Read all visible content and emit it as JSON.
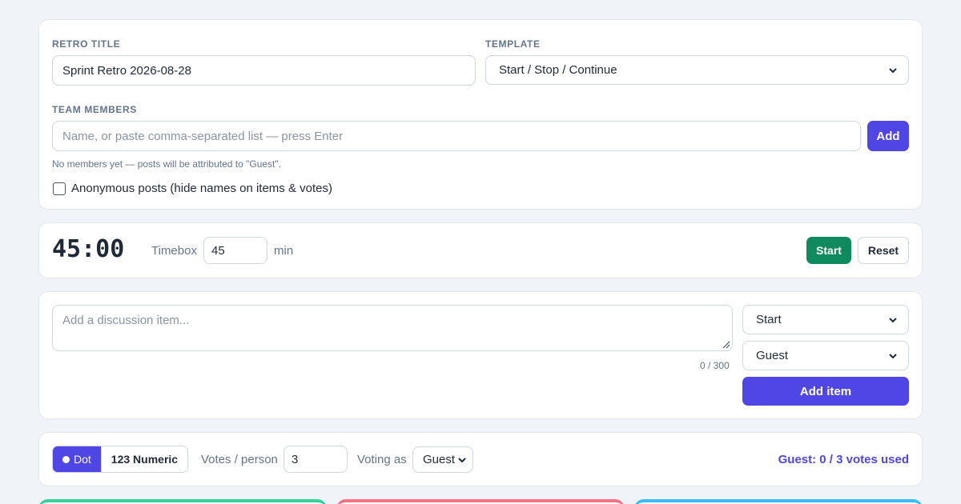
{
  "setup": {
    "retro_title_label": "RETRO TITLE",
    "retro_title_value": "Sprint Retro 2026-08-28",
    "template_label": "TEMPLATE",
    "template_value": "Start / Stop / Continue",
    "team_members_label": "TEAM MEMBERS",
    "team_members_placeholder": "Name, or paste comma-separated list — press Enter",
    "add_label": "Add",
    "members_hint": "No members yet — posts will be attributed to \"Guest\".",
    "anonymous_label": "Anonymous posts (hide names on items & votes)"
  },
  "timer": {
    "display": "45:00",
    "timebox_label": "Timebox",
    "timebox_value": "45",
    "unit_label": "min",
    "start_label": "Start",
    "reset_label": "Reset"
  },
  "composer": {
    "placeholder": "Add a discussion item...",
    "char_count": "0 / 300",
    "column_value": "Start",
    "author_value": "Guest",
    "add_item_label": "Add item"
  },
  "voting": {
    "mode_dot_label": "Dot",
    "mode_numeric_label": "123 Numeric",
    "votes_per_person_label": "Votes / person",
    "votes_per_person_value": "3",
    "voting_as_label": "Voting as",
    "voting_as_value": "Guest",
    "votes_used": "Guest: 0 / 3 votes used"
  },
  "colors": {
    "accent": "#4f46e5",
    "start_green": "#0f8a5f",
    "column_start": "#34d399",
    "column_stop": "#f87185",
    "column_continue": "#38bdf8"
  }
}
